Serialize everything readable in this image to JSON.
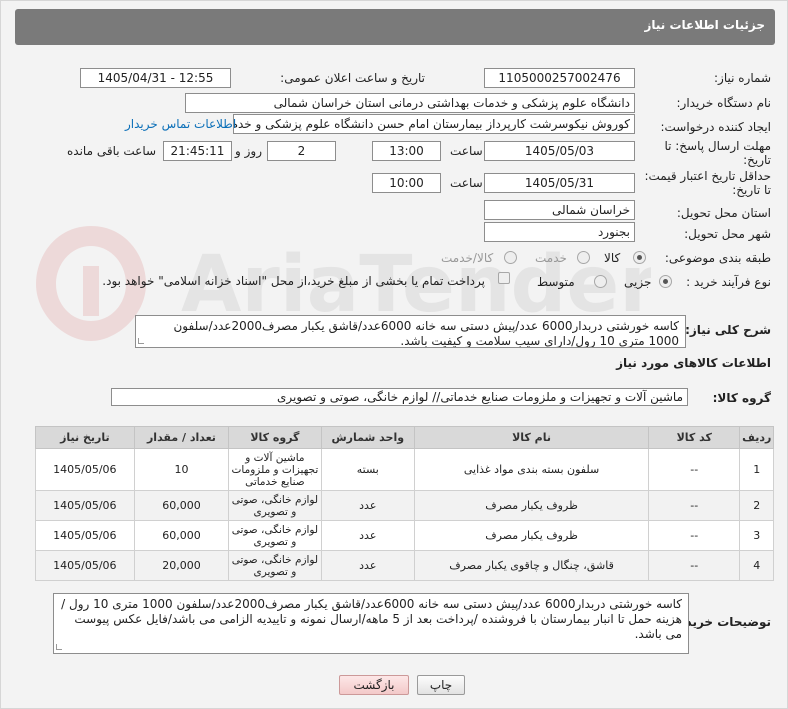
{
  "header": {
    "title": "جزئیات اطلاعات نیاز"
  },
  "form": {
    "need_number": {
      "label": "شماره نیاز:",
      "value": "1105000257002476"
    },
    "announce": {
      "label": "تاریخ و ساعت اعلان عمومی:",
      "value": "1405/04/31 - 12:55"
    },
    "buyer_org": {
      "label": "نام دستگاه خریدار:",
      "value": "دانشگاه علوم پزشکی و خدمات بهداشتی درمانی استان خراسان شمالی"
    },
    "requester": {
      "label": "ایجاد کننده درخواست:",
      "value": "کوروش نیکوسرشت کارپرداز بیمارستان امام حسن دانشگاه علوم پزشکی و خدم",
      "contact_link": "اطلاعات تماس خریدار"
    },
    "reply_deadline": {
      "label_line1": "مهلت ارسال پاسخ: تا",
      "label_line2": "تاریخ:",
      "date": "1405/05/03",
      "time_label": "ساعت",
      "time": "13:00",
      "days": "2",
      "days_label": "روز و",
      "remaining": "21:45:11",
      "remaining_label": "ساعت باقی مانده"
    },
    "price_validity": {
      "label_line1": "حداقل تاریخ اعتبار قیمت:",
      "label_line2": "تا تاریخ:",
      "date": "1405/05/31",
      "time_label": "ساعت",
      "time": "10:00"
    },
    "delivery_province": {
      "label": "استان محل تحویل:",
      "value": "خراسان شمالی"
    },
    "delivery_city": {
      "label": "شهر محل تحویل:",
      "value": "بجنورد"
    },
    "category": {
      "label": "طبقه بندی موضوعی:",
      "options": [
        "کالا",
        "خدمت",
        "کالا/خدمت"
      ],
      "selected": "کالا"
    },
    "purchase_type": {
      "label": "نوع فرآیند خرید :",
      "options": [
        "جزیی",
        "متوسط"
      ],
      "selected": "جزیی",
      "payment_note": "پرداخت تمام یا بخشی از مبلغ خرید،از محل \"اسناد خزانه اسلامی\" خواهد بود."
    }
  },
  "general_description": {
    "label": "شرح کلی نیاز:",
    "text": "کاسه خورشتی دربدار6000 عدد/پیش دستی سه خانه 6000عدد/قاشق یکبار مصرف2000عدد/سلفون 1000 متری 10 رول/دارای سیب سلامت و کیفیت باشد."
  },
  "goods_info": {
    "title": "اطلاعات کالاهای مورد نیاز",
    "group_label": "گروه کالا:",
    "group_value": "ماشین آلات و تجهیزات و ملزومات صنایع خدماتی// لوازم خانگی، صوتی و تصویری"
  },
  "table": {
    "headers": [
      "ردیف",
      "کد کالا",
      "نام کالا",
      "واحد شمارش",
      "گروه کالا",
      "تعداد / مقدار",
      "تاریخ نیاز"
    ],
    "rows": [
      {
        "row": "1",
        "code": "--",
        "name": "سلفون بسته بندی مواد غذایی",
        "unit": "بسته",
        "group": "ماشین آلات و تجهیزات و ملزومات صنایع خدماتی",
        "qty": "10",
        "date": "1405/05/06"
      },
      {
        "row": "2",
        "code": "--",
        "name": "ظروف یکبار مصرف",
        "unit": "عدد",
        "group": "لوازم خانگی، صوتی و تصویری",
        "qty": "60,000",
        "date": "1405/05/06"
      },
      {
        "row": "3",
        "code": "--",
        "name": "ظروف یکبار مصرف",
        "unit": "عدد",
        "group": "لوازم خانگی، صوتی و تصویری",
        "qty": "60,000",
        "date": "1405/05/06"
      },
      {
        "row": "4",
        "code": "--",
        "name": "قاشق، چنگال و چاقوی یکبار مصرف",
        "unit": "عدد",
        "group": "لوازم خانگی، صوتی و تصویری",
        "qty": "20,000",
        "date": "1405/05/06"
      }
    ]
  },
  "buyer_notes": {
    "label": "توضیحات خریدار:",
    "text": "کاسه خورشتی دربدار6000 عدد/پیش دستی سه خانه 6000عدد/قاشق یکبار مصرف2000عدد/سلفون 1000 متری 10 رول / هزینه حمل تا انبار بیمارستان با فروشنده /پرداخت بعد از 5 ماهه/ارسال نمونه و تاییدیه الزامی می باشد/فایل عکس پیوست می باشد."
  },
  "buttons": {
    "print": "چاپ",
    "back": "بازگشت"
  },
  "watermark": {
    "brand": "AriaTender.net"
  }
}
